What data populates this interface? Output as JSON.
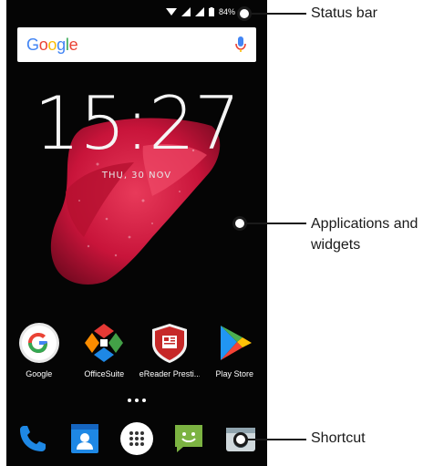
{
  "status_bar": {
    "battery_text": "84%"
  },
  "search_widget": {
    "logo_letters": [
      "G",
      "o",
      "o",
      "g",
      "l",
      "e"
    ]
  },
  "clock": {
    "time": "15:27",
    "date": "THU, 30 NOV"
  },
  "apps": [
    {
      "label": "Google",
      "icon": "google-app-icon"
    },
    {
      "label": "OfficeSuite",
      "icon": "officesuite-icon"
    },
    {
      "label": "eReader Presti...",
      "icon": "ereader-icon"
    },
    {
      "label": "Play Store",
      "icon": "play-store-icon"
    }
  ],
  "dock": [
    {
      "icon": "phone-icon"
    },
    {
      "icon": "contacts-icon"
    },
    {
      "icon": "app-drawer-icon"
    },
    {
      "icon": "messaging-icon"
    },
    {
      "icon": "camera-icon"
    }
  ],
  "callouts": {
    "status_bar": "Status bar",
    "applications_line1": "Applications and",
    "applications_line2": "widgets",
    "shortcut": "Shortcut"
  },
  "colors": {
    "screen_background": "#050505",
    "wallpaper_red": "#d3173f",
    "google_blue": "#4285F4",
    "google_red": "#EA4335",
    "google_yellow": "#FBBC05",
    "google_green": "#34A853",
    "callout_color": "#1a1a1a"
  }
}
